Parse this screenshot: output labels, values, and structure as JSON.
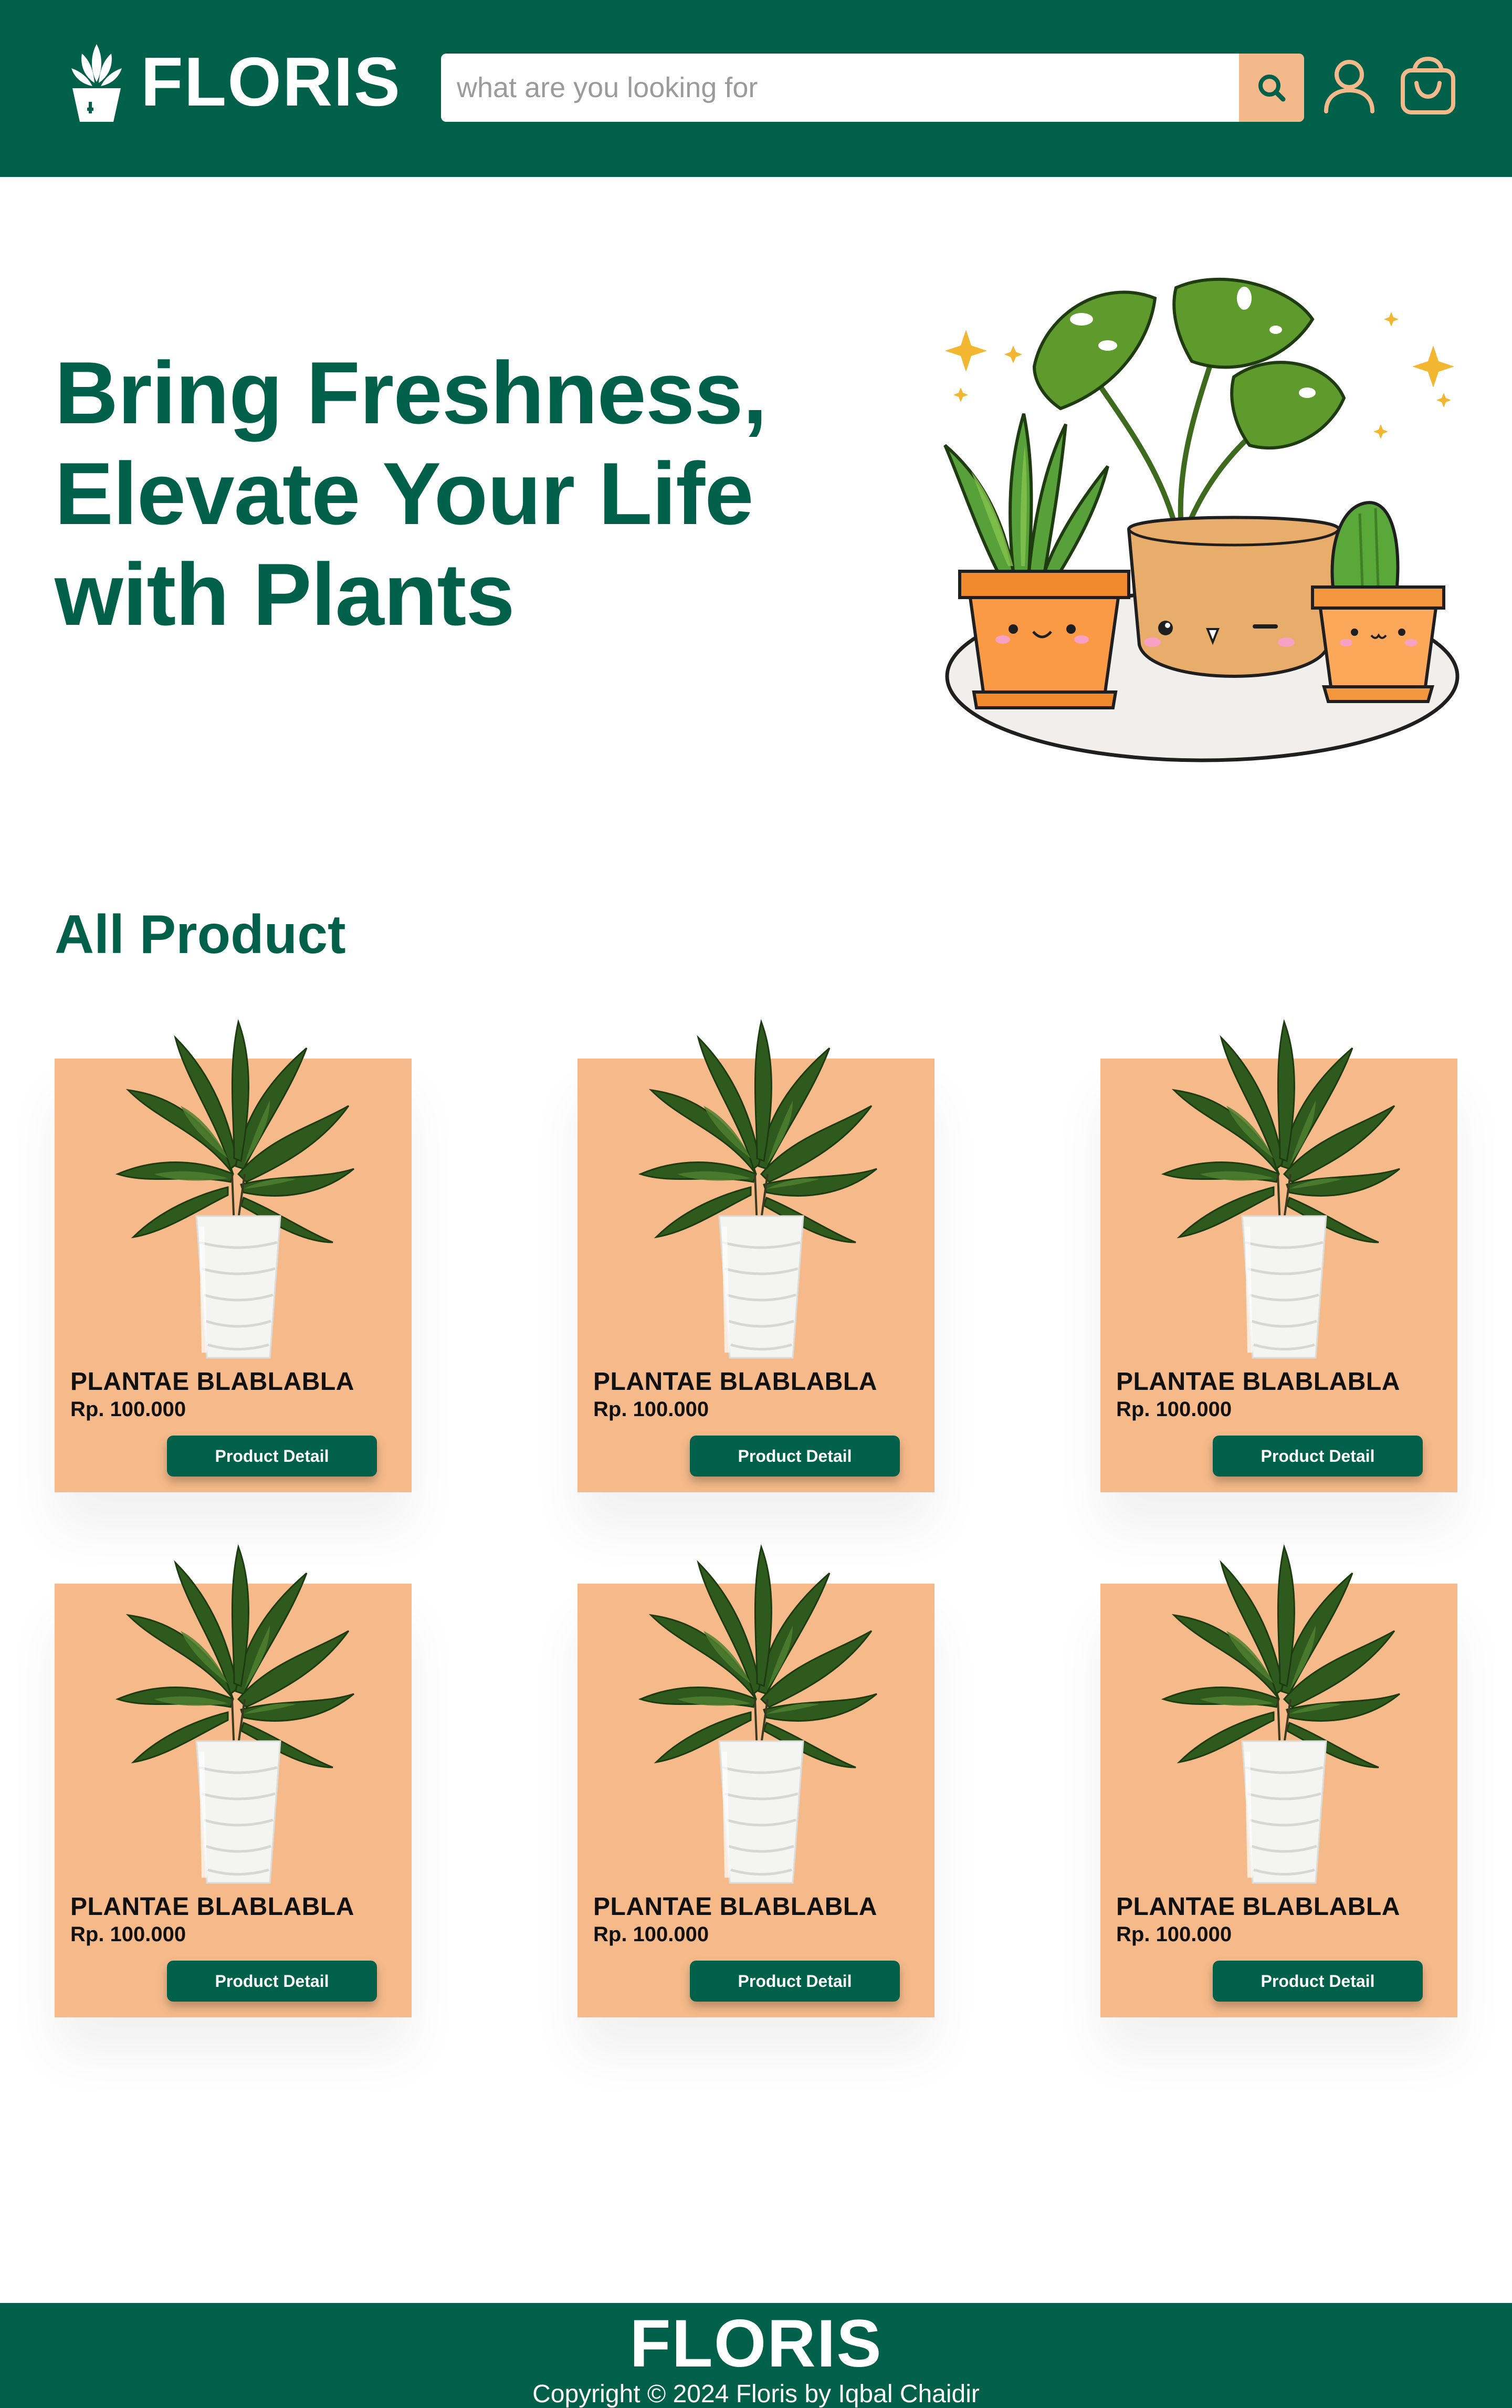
{
  "brand": {
    "name": "FLORIS",
    "color_primary": "#00604a",
    "color_accent": "#f4b98b"
  },
  "header": {
    "search": {
      "placeholder": "what are you looking for",
      "value": ""
    },
    "icons": [
      "search-icon",
      "user-icon",
      "shopping-bag-icon"
    ]
  },
  "hero": {
    "title_lines": [
      "Bring Freshness,",
      "Elevate Your Life",
      "with Plants"
    ]
  },
  "products": {
    "section_title": "All Product",
    "items": [
      {
        "name": "PLANTAE BLABLABLA",
        "price": "Rp. 100.000",
        "button": "Product Detail"
      },
      {
        "name": "PLANTAE BLABLABLA",
        "price": "Rp. 100.000",
        "button": "Product Detail"
      },
      {
        "name": "PLANTAE BLABLABLA",
        "price": "Rp. 100.000",
        "button": "Product Detail"
      },
      {
        "name": "PLANTAE BLABLABLA",
        "price": "Rp. 100.000",
        "button": "Product Detail"
      },
      {
        "name": "PLANTAE BLABLABLA",
        "price": "Rp. 100.000",
        "button": "Product Detail"
      },
      {
        "name": "PLANTAE BLABLABLA",
        "price": "Rp. 100.000",
        "button": "Product Detail"
      }
    ]
  },
  "footer": {
    "logo": "FLORIS",
    "copyright": "Copyright © 2024 Floris by Iqbal Chaidir"
  }
}
